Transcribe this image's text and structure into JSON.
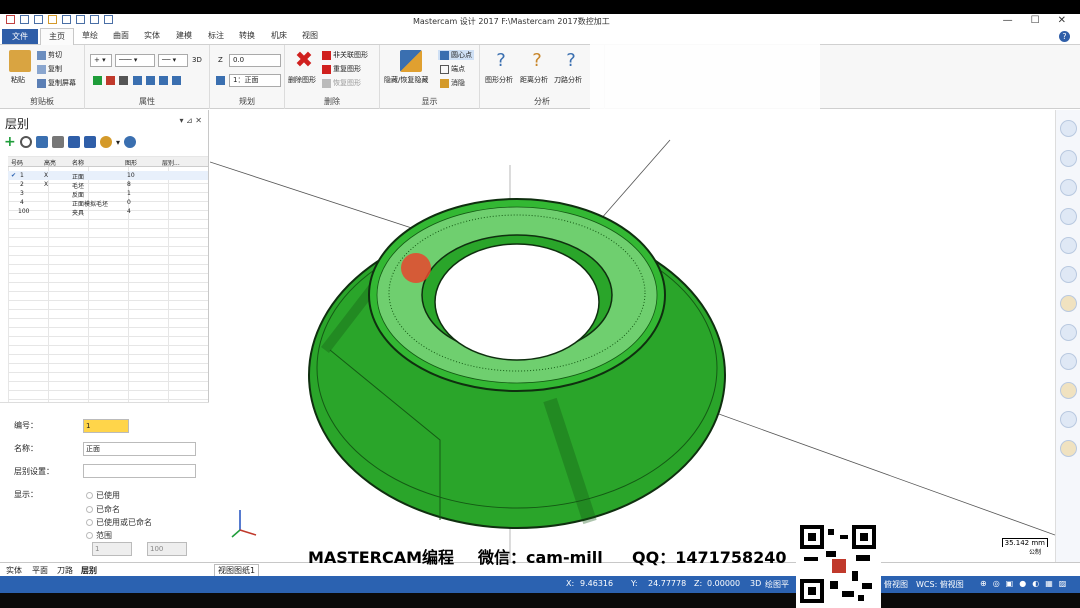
{
  "title_bar": {
    "app_title": "Mastercam 设计 2017  F:\\Mastercam 2017数控加工"
  },
  "tabs": {
    "file": "文件",
    "items": [
      "主页",
      "草绘",
      "曲面",
      "实体",
      "建模",
      "标注",
      "转换",
      "机床",
      "视图"
    ]
  },
  "ribbon": {
    "clipboard": {
      "label": "剪贴板",
      "paste": "粘贴",
      "cut": "剪切",
      "copy": "复制",
      "copy_screen": "复制屏幕"
    },
    "attributes": {
      "label": "属性",
      "mode_3d": "3D"
    },
    "planning": {
      "label": "规划",
      "z_label": "Z",
      "z_value": "0.0",
      "level_value": "1：正面"
    },
    "delete": {
      "label": "删除",
      "delete_entity": "删除图形",
      "non_assoc": "非关联图形",
      "repeat": "重复图形",
      "restore": "恢复图形"
    },
    "display": {
      "label": "显示",
      "hide_show": "隐藏/恢复隐藏",
      "center": "圆心点",
      "endpoints": "端点",
      "hide": "消隐"
    },
    "analysis": {
      "label": "分析",
      "entity_analysis": "图形分析",
      "distance_analysis": "距离分析",
      "toolpath_analysis": "刀路分析"
    }
  },
  "levels_panel": {
    "title": "层别",
    "columns": [
      "号码",
      "高亮",
      "名称",
      "图形",
      "层别..."
    ],
    "rows": [
      {
        "number": "1",
        "highlight": "X",
        "name": "正面",
        "count": "10",
        "active": true
      },
      {
        "number": "2",
        "highlight": "X",
        "name": "毛坯",
        "count": "8",
        "active": false
      },
      {
        "number": "3",
        "highlight": "",
        "name": "反面",
        "count": "1",
        "active": false
      },
      {
        "number": "4",
        "highlight": "",
        "name": "正面模拟毛坯",
        "count": "0",
        "active": false
      },
      {
        "number": "100",
        "highlight": "",
        "name": "夹具",
        "count": "4",
        "active": false
      }
    ],
    "props": {
      "number_label": "编号：",
      "number_value": "1",
      "name_label": "名称：",
      "name_value": "正面",
      "level_set_label": "层别设置：",
      "level_set_value": "",
      "display_label": "显示：",
      "options": [
        "已使用",
        "已命名",
        "已使用或已命名",
        "范围"
      ],
      "range_from": "1",
      "range_to": "100"
    }
  },
  "bottom_tabs": [
    "实体",
    "平面",
    "刀路",
    "层别"
  ],
  "view_sheet_tab": "视图图纸1",
  "status_bar": {
    "x_label": "X:",
    "x_value": "9.46316",
    "y_label": "Y:",
    "y_value": "24.77778",
    "z_label": "Z:",
    "z_value": "0.00000",
    "mode": "3D",
    "plane": "绘图平",
    "view": "俯视图",
    "wcs": "WCS: 俯视图"
  },
  "scale": {
    "value": "35.142 mm",
    "unit": "公制"
  },
  "watermark": {
    "left": "MASTERCAM编程",
    "wechat": "微信：cam-mill",
    "qq": "QQ：1471758240"
  },
  "colors": {
    "accent": "#2b62b1",
    "part_green": "#2fb52f",
    "file_tab": "#2f5ea8"
  }
}
